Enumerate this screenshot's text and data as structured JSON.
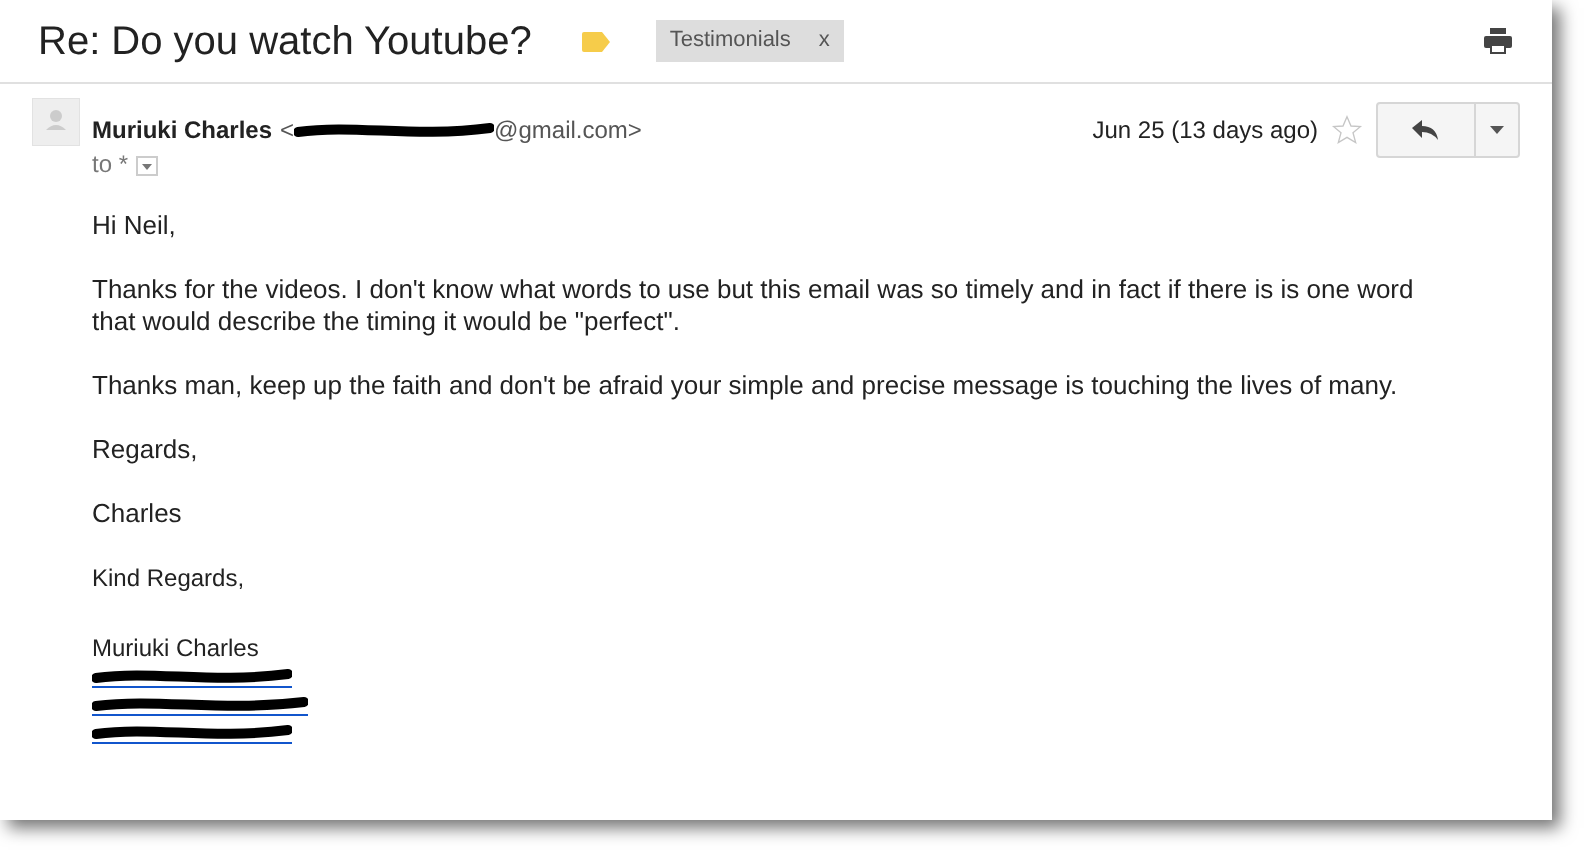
{
  "subject": "Re: Do you watch Youtube?",
  "label": {
    "text": "Testimonials",
    "close": "x"
  },
  "sender": {
    "name": "Muriuki Charles",
    "email_open": "<",
    "email_domain": "@gmail.com>",
    "email_redacted": true
  },
  "recipient": {
    "text": "to *"
  },
  "date": "Jun 25 (13 days ago)",
  "starred": false,
  "body": [
    "Hi Neil,",
    "Thanks for the videos. I don't know what words to use but this email was so timely and in fact if there is is one word that would describe the timing it would be \"perfect\".",
    "Thanks man, keep up the faith and don't be afraid your simple and precise message is touching the lives of many.",
    "Regards,",
    "Charles"
  ],
  "signature": {
    "closing": "Kind Regards,",
    "name": "Muriuki Charles",
    "phones": [
      {
        "kind": "redacted"
      },
      {
        "kind": "redacted"
      },
      {
        "kind": "redacted"
      }
    ]
  }
}
